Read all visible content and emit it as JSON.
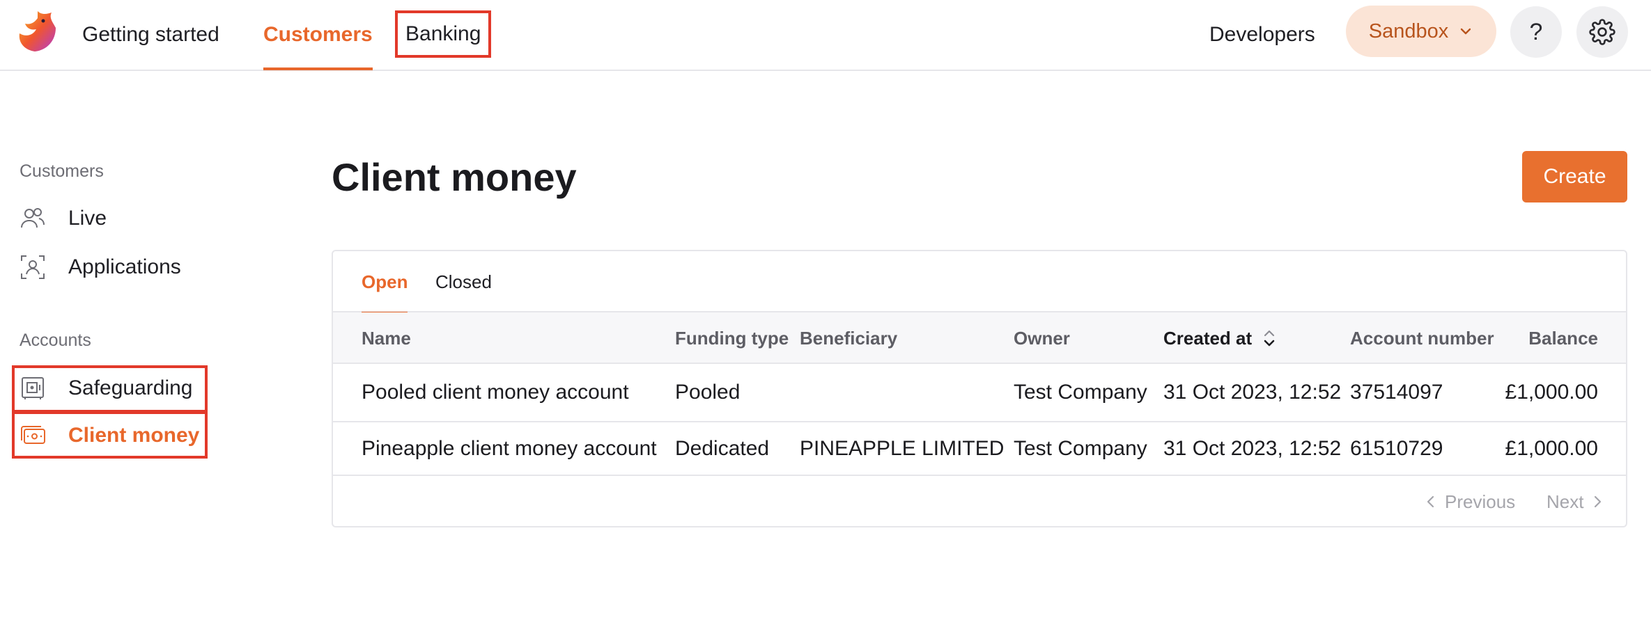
{
  "nav": {
    "items": [
      {
        "label": "Getting started"
      },
      {
        "label": "Customers"
      },
      {
        "label": "Banking"
      }
    ],
    "developers": "Developers",
    "environment": "Sandbox",
    "help": "?"
  },
  "sidebar": {
    "customers_heading": "Customers",
    "customers_items": [
      {
        "label": "Live",
        "icon": "users-icon"
      },
      {
        "label": "Applications",
        "icon": "user-scan-icon"
      }
    ],
    "accounts_heading": "Accounts",
    "accounts_items": [
      {
        "label": "Safeguarding",
        "icon": "safe-icon"
      },
      {
        "label": "Client money",
        "icon": "money-icon"
      }
    ]
  },
  "main": {
    "title": "Client money",
    "create_label": "Create",
    "tabs": [
      {
        "label": "Open"
      },
      {
        "label": "Closed"
      }
    ],
    "table": {
      "columns": [
        "Name",
        "Funding type",
        "Beneficiary",
        "Owner",
        "Created at",
        "Account number",
        "Balance"
      ],
      "rows": [
        {
          "name": "Pooled client money account",
          "funding_type": "Pooled",
          "beneficiary": "",
          "owner": "Test Company",
          "created_at": "31 Oct 2023, 12:52",
          "account_number": "37514097",
          "balance": "£1,000.00"
        },
        {
          "name": "Pineapple client money account",
          "funding_type": "Dedicated",
          "beneficiary": "PINEAPPLE LIMITED",
          "owner": "Test Company",
          "created_at": "31 Oct 2023, 12:52",
          "account_number": "61510729",
          "balance": "£1,000.00"
        }
      ]
    },
    "pagination": {
      "previous": "Previous",
      "next": "Next"
    }
  },
  "colors": {
    "accent": "#e8672b",
    "create_button": "#e8702f",
    "sandbox_bg": "#fbe4d6",
    "highlight_box": "#e2392a"
  }
}
